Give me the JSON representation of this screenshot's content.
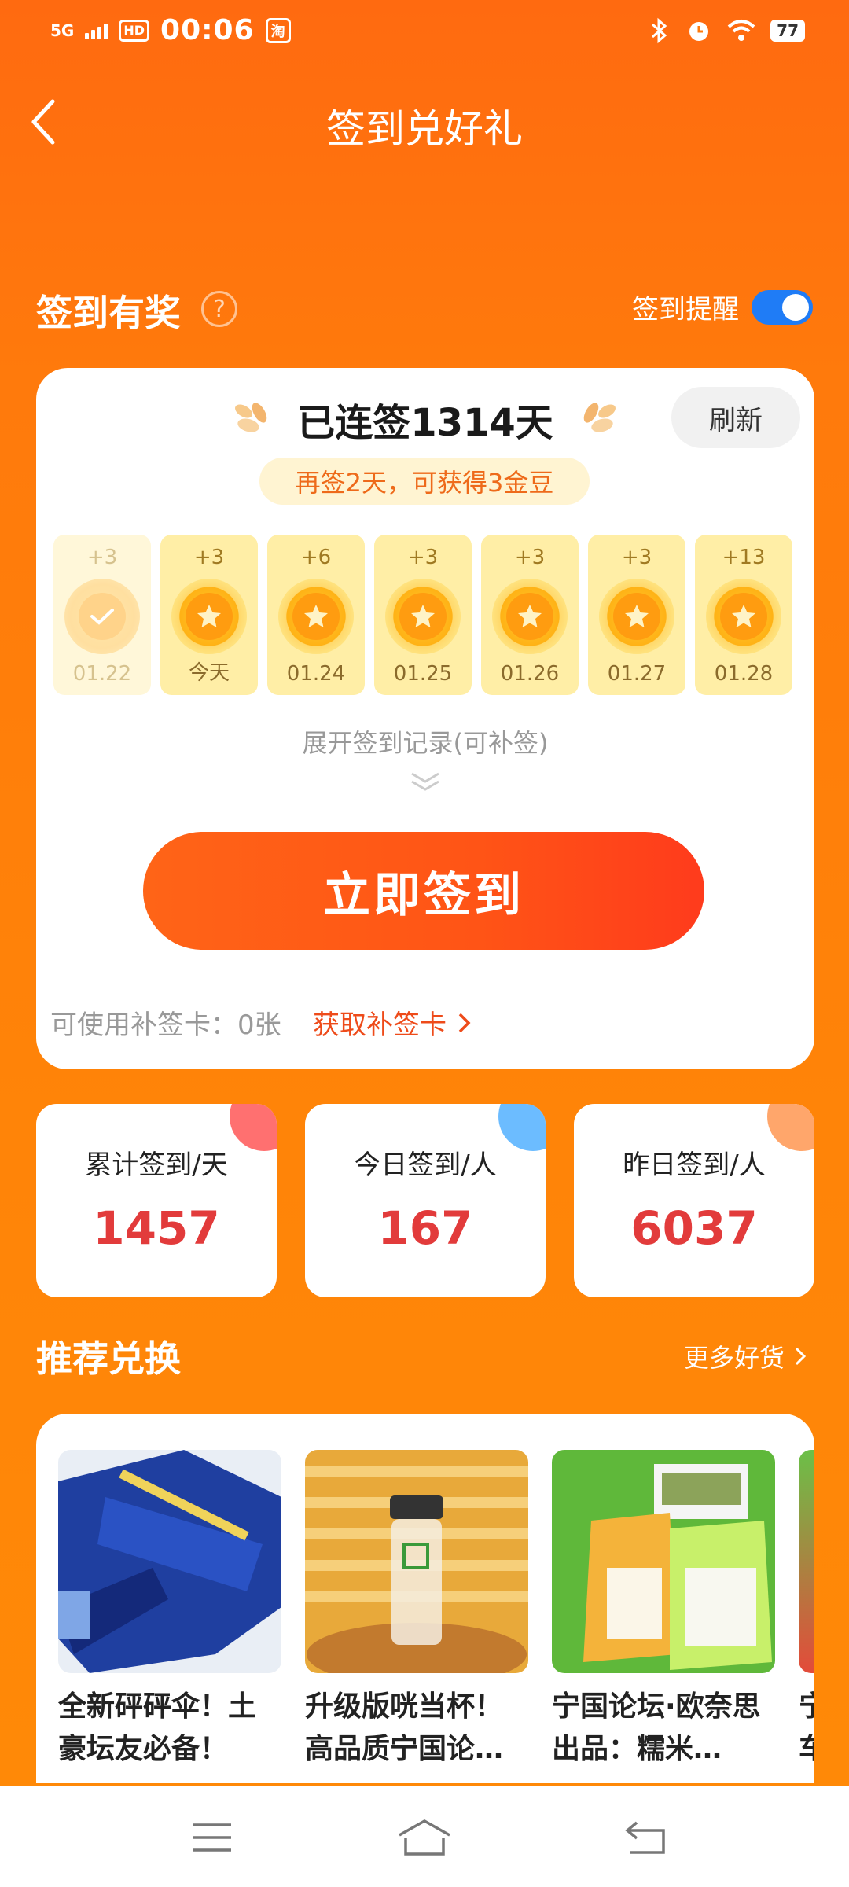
{
  "status_bar": {
    "network": "5G",
    "hd": "HD",
    "time": "00:06",
    "app_badge": "淘",
    "battery": "77"
  },
  "header": {
    "title": "签到兑好礼"
  },
  "checkin_section": {
    "title": "签到有奖",
    "help": "?",
    "reminder_label": "签到提醒",
    "reminder_on": true
  },
  "sign_card": {
    "streak_text": "已连签1314天",
    "refresh_label": "刷新",
    "bonus_tip": "再签2天，可获得3金豆",
    "days": [
      {
        "points": "+3",
        "date": "01.22",
        "state": "done"
      },
      {
        "points": "+3",
        "date": "今天",
        "state": "today"
      },
      {
        "points": "+6",
        "date": "01.24",
        "state": "future"
      },
      {
        "points": "+3",
        "date": "01.25",
        "state": "future"
      },
      {
        "points": "+3",
        "date": "01.26",
        "state": "future"
      },
      {
        "points": "+3",
        "date": "01.27",
        "state": "future"
      },
      {
        "points": "+13",
        "date": "01.28",
        "state": "future"
      }
    ],
    "expand_label": "展开签到记录(可补签)",
    "sign_button": "立即签到",
    "makeup_card_text": "可使用补签卡：0张",
    "get_makeup_card": "获取补签卡"
  },
  "stats": [
    {
      "label": "累计签到/天",
      "value": "1457",
      "accent": "#ff7070"
    },
    {
      "label": "今日签到/人",
      "value": "167",
      "accent": "#6cbcff"
    },
    {
      "label": "昨日签到/人",
      "value": "6037",
      "accent": "#ffa66b"
    }
  ],
  "recommend": {
    "title": "推荐兑换",
    "more_label": "更多好货",
    "products": [
      {
        "title": "全新砰砰伞！土豪坛友必备！",
        "image": "umbrella-photo"
      },
      {
        "title": "升级版咣当杯！高品质宁国论…",
        "image": "cup-photo"
      },
      {
        "title": "宁国论坛·欧奈思出品：糯米…",
        "image": "rice-snack-photo"
      }
    ],
    "partial_product_title": "宁车"
  },
  "colors": {
    "primary_orange": "#ff7a0c",
    "button_red": "#ff4d18",
    "stat_value": "#e23b3b",
    "toggle_blue": "#1f7cf6"
  }
}
